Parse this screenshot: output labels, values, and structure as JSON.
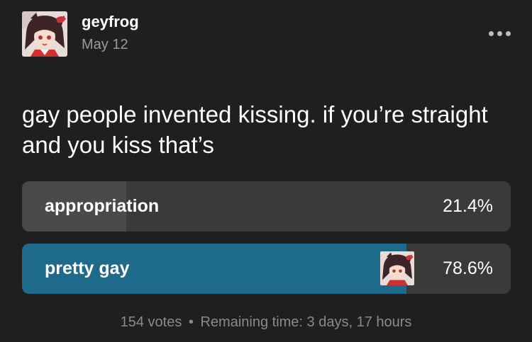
{
  "post": {
    "author": "geyfrog",
    "date": "May 12",
    "question": "gay people invented kissing. if you’re straight and you kiss that’s"
  },
  "poll": {
    "options": [
      {
        "label": "appropriation",
        "percent": "21.4%",
        "fraction": 0.214,
        "selected": false
      },
      {
        "label": "pretty gay",
        "percent": "78.6%",
        "fraction": 0.786,
        "selected": true
      }
    ],
    "votes": "154 votes",
    "separator": "•",
    "remaining": "Remaining time: 3 days, 17 hours"
  },
  "colors": {
    "background": "#1f1f1f",
    "option_bg": "#3a3a3a",
    "option_fill": "#4a4a4a",
    "selected_fill": "#1e6a8a"
  },
  "icons": {
    "more": "more-dots-icon"
  }
}
